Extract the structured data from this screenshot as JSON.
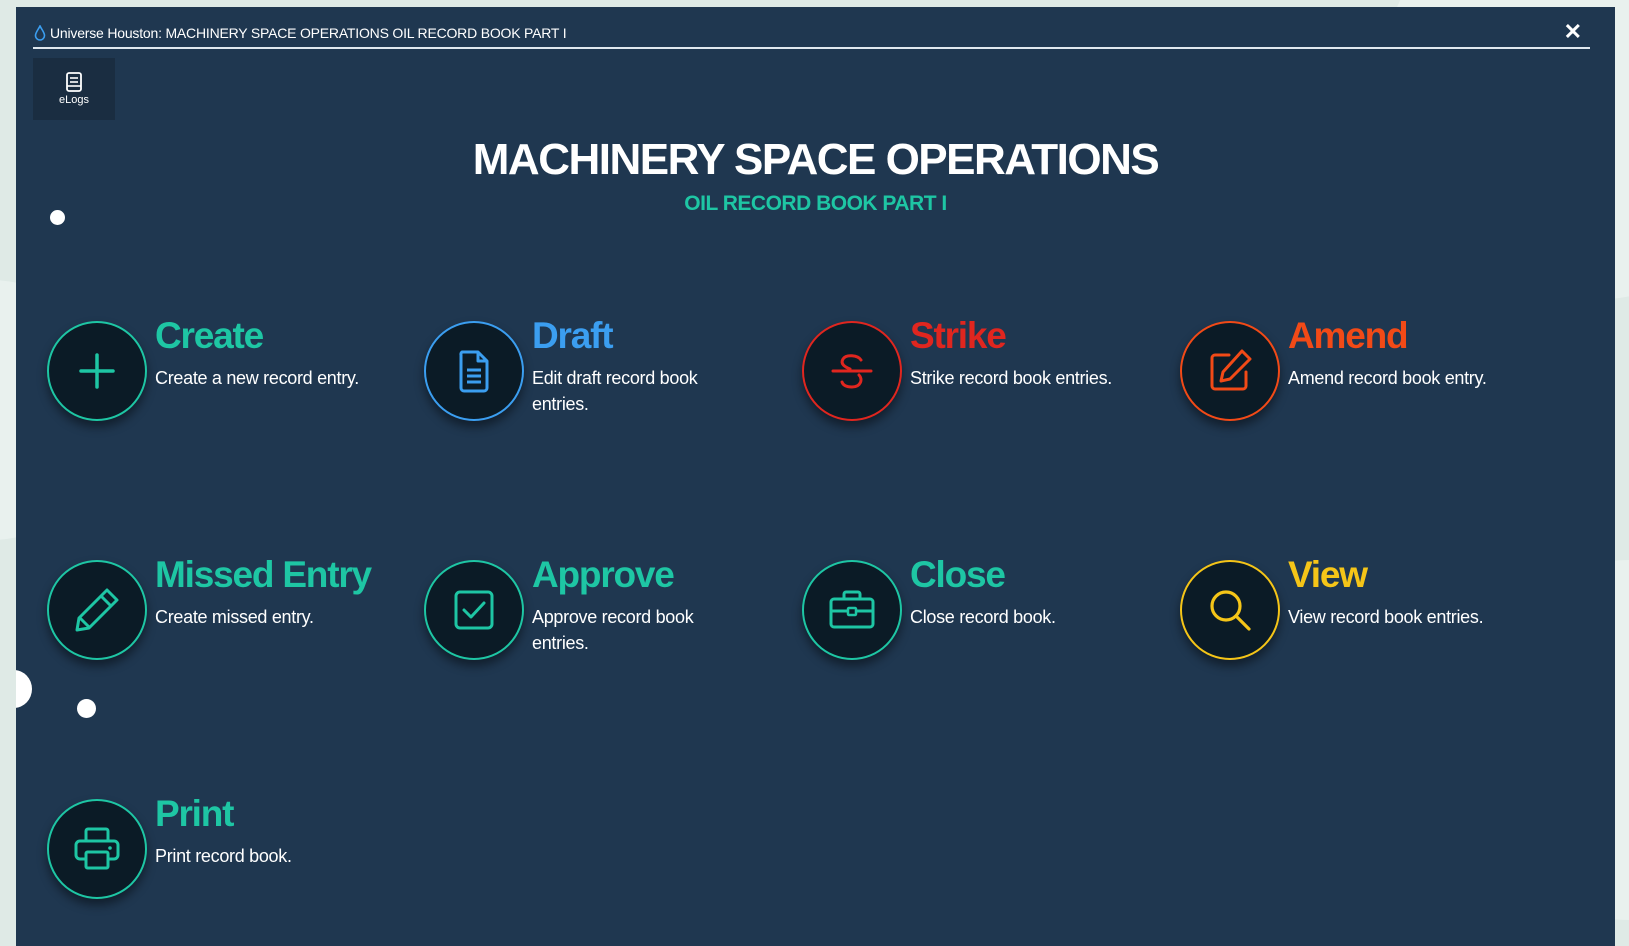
{
  "window": {
    "title": "Universe Houston: MACHINERY SPACE OPERATIONS OIL RECORD BOOK PART I",
    "close_label": "✕"
  },
  "toolbar": {
    "elogs_label": "eLogs"
  },
  "page": {
    "heading": "MACHINERY SPACE OPERATIONS",
    "subheading": "OIL RECORD BOOK PART I"
  },
  "colors": {
    "teal": "#1ec6a4",
    "blue": "#3b9ef0",
    "red": "#e0261f",
    "orange": "#f24a17",
    "yellow": "#f5c518",
    "window_bg": "#1f3750"
  },
  "actions": [
    {
      "name": "Create",
      "desc": "Create a new record entry.",
      "icon": "plus-icon",
      "color": "#1ec6a4"
    },
    {
      "name": "Draft",
      "desc": "Edit draft record book entries.",
      "icon": "document-icon",
      "color": "#3b9ef0"
    },
    {
      "name": "Strike",
      "desc": "Strike record book entries.",
      "icon": "strikethrough-icon",
      "color": "#e0261f"
    },
    {
      "name": "Amend",
      "desc": "Amend record book entry.",
      "icon": "edit-icon",
      "color": "#f24a17"
    },
    {
      "name": "Missed Entry",
      "desc": "Create missed entry.",
      "icon": "pencil-icon",
      "color": "#1ec6a4"
    },
    {
      "name": "Approve",
      "desc": "Approve record book entries.",
      "icon": "checkbox-icon",
      "color": "#1ec6a4"
    },
    {
      "name": "Close",
      "desc": "Close record book.",
      "icon": "briefcase-icon",
      "color": "#1ec6a4"
    },
    {
      "name": "View",
      "desc": "View record book entries.",
      "icon": "search-icon",
      "color": "#f5c518"
    },
    {
      "name": "Print",
      "desc": "Print record book.",
      "icon": "printer-icon",
      "color": "#1ec6a4"
    }
  ]
}
